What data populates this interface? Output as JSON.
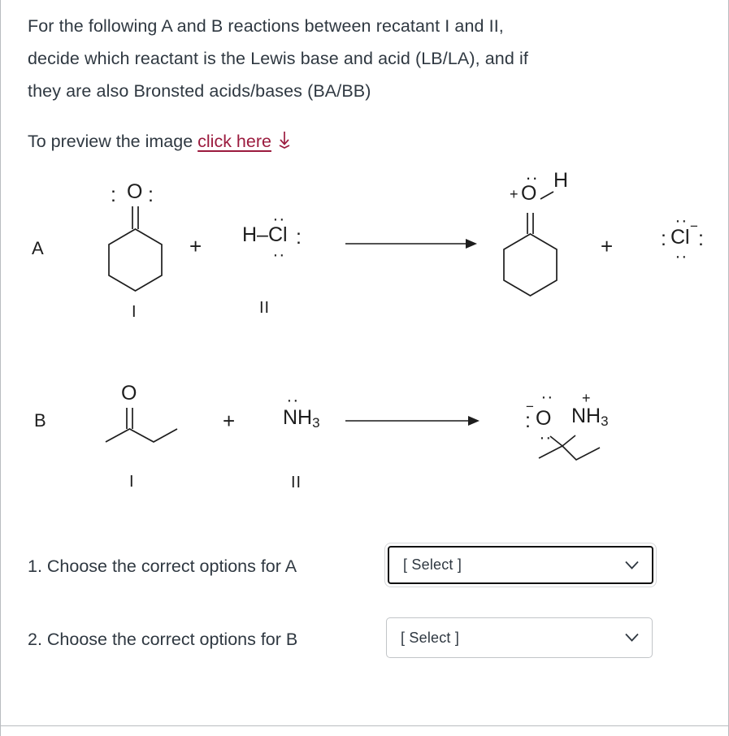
{
  "prompt": {
    "line1": "For the following A and B reactions between recatant I and II,",
    "line2": "decide which reactant is the Lewis base and acid (LB/LA), and if",
    "line3": "they are also Bronsted acids/bases (BA/BB)",
    "preview_prefix": "To preview the image ",
    "preview_link": "click here",
    "download_icon": "download-arrow-icon",
    "link_color": "#9b1b3e"
  },
  "scheme": {
    "reaction_a": {
      "label": "A",
      "reactant1": {
        "name": "cyclohexanone",
        "atom_label": "O",
        "lone_pair_left": ":",
        "lone_pair_right": ":",
        "numeral": "I"
      },
      "plus_reactants": "+",
      "reactant2": {
        "name": "hydrogen-chloride",
        "formula": "H–Cl",
        "lone_pair_top": "··",
        "lone_pair_bottom": "··",
        "lone_pair_right": ":",
        "numeral": "II"
      },
      "arrow": "reaction-arrow-right",
      "product1": {
        "name": "protonated-cyclohexanone",
        "atom_label": "O",
        "charge": "+",
        "hydrogen": "H",
        "lone_pair_top": "··"
      },
      "plus_products": "+",
      "product2": {
        "name": "chloride-ion",
        "atom_label": "Cl",
        "charge": "−",
        "lone_pair_left": ":",
        "lone_pair_right": ":",
        "lone_pair_top": "··",
        "lone_pair_bottom": "··"
      }
    },
    "reaction_b": {
      "label": "B",
      "reactant1": {
        "name": "butan-2-one",
        "atom_label": "O",
        "numeral": "I"
      },
      "plus_reactants": "+",
      "reactant2": {
        "name": "ammonia",
        "formula": "NH",
        "subscript": "3",
        "lone_pair_top": "··",
        "numeral": "II"
      },
      "arrow": "reaction-arrow-right",
      "product1": {
        "name": "tetrahedral-intermediate",
        "oxygen_label": "O",
        "oxygen_charge": "−",
        "oxygen_lone_pair_left": ":",
        "oxygen_lone_pair_top": "··",
        "oxygen_lone_pair_bottom": "··",
        "nitrogen_label": "NH",
        "nitrogen_subscript": "3",
        "nitrogen_charge": "+"
      }
    }
  },
  "questions": [
    {
      "text": "1. Choose the correct options for A",
      "select_value": "[ Select ]",
      "state": "focused"
    },
    {
      "text": "2. Choose the correct options for B",
      "select_value": "[ Select ]",
      "state": "default"
    }
  ]
}
